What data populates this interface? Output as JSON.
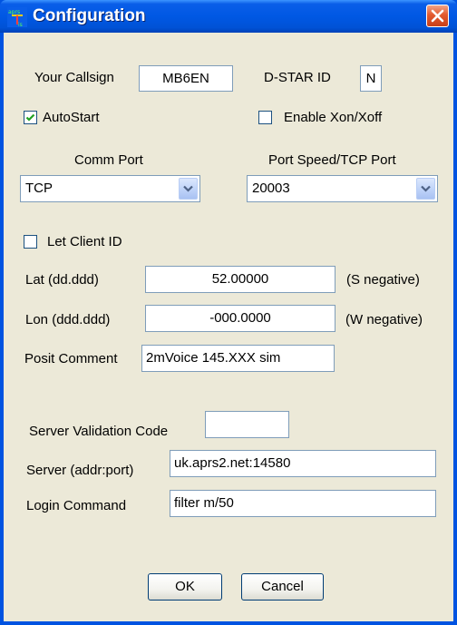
{
  "window": {
    "title": "Configuration"
  },
  "form": {
    "callsign_label": "Your Callsign",
    "callsign_value": "MB6EN",
    "dstar_label": "D-STAR ID",
    "dstar_value": "N",
    "autostart_label": "AutoStart",
    "autostart_checked": true,
    "xon_label": "Enable Xon/Xoff",
    "xon_checked": false,
    "comm_port_label": "Comm Port",
    "comm_port_value": "TCP",
    "port_speed_label": "Port Speed/TCP Port",
    "port_speed_value": "20003",
    "let_client_label": "Let Client ID",
    "let_client_checked": false,
    "lat_label": "Lat (dd.ddd)",
    "lat_value": "52.00000",
    "lat_hint": "(S negative)",
    "lon_label": "Lon (ddd.ddd)",
    "lon_value": "-000.0000",
    "lon_hint": "(W negative)",
    "posit_label": "Posit Comment",
    "posit_value": "2mVoice 145.XXX sim",
    "server_code_label": "Server Validation Code",
    "server_code_value": "",
    "server_label": "Server (addr:port)",
    "server_value": "uk.aprs2.net:14580",
    "login_label": "Login Command",
    "login_value": "filter m/50"
  },
  "buttons": {
    "ok": "OK",
    "cancel": "Cancel"
  },
  "colors": {
    "titlebar": "#0058e4",
    "face": "#ece9d8",
    "field_border": "#7f9db9",
    "check": "#21a121"
  }
}
